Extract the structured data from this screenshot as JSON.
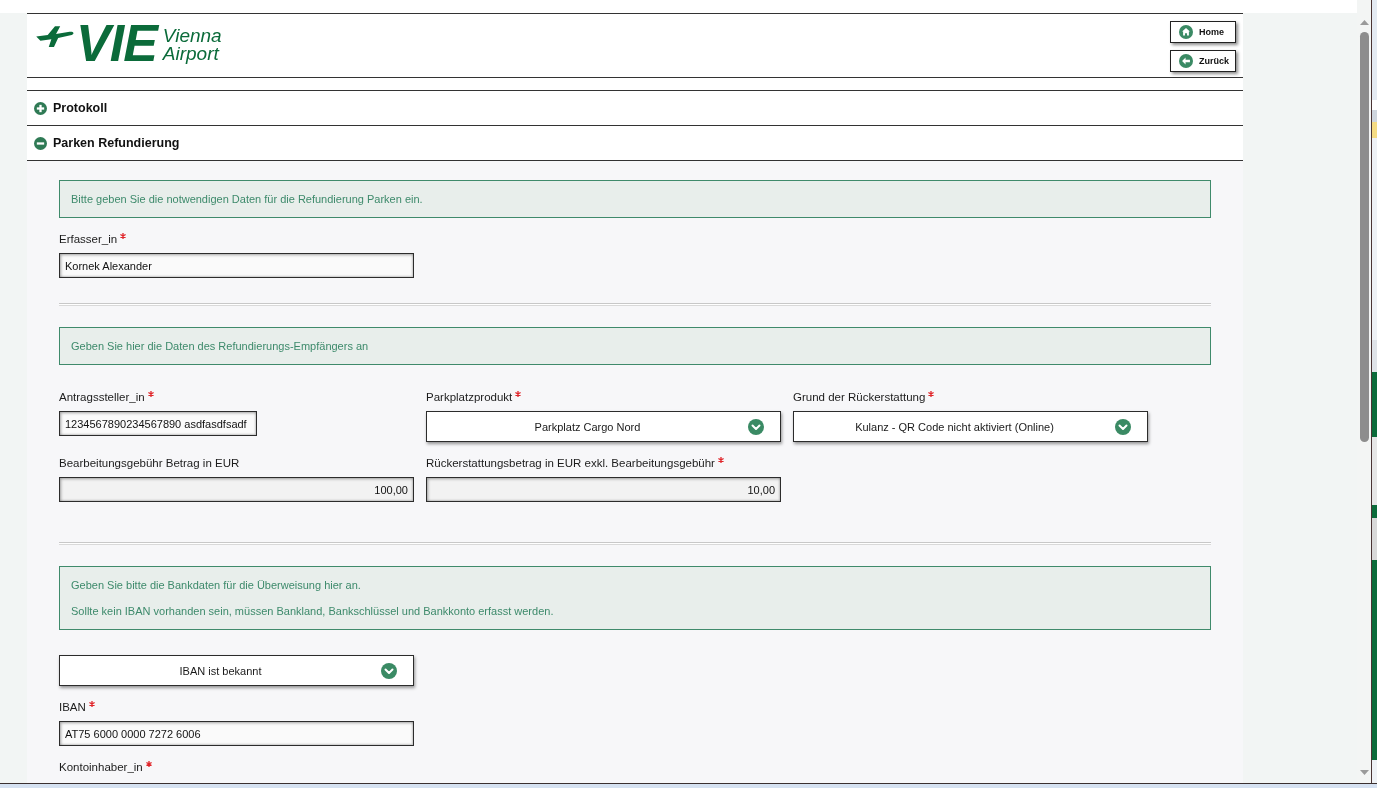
{
  "header": {
    "logo": {
      "mark": "VIE",
      "lines": [
        "Vienna",
        "Airport"
      ]
    },
    "buttons": [
      {
        "kind": "home",
        "label": "Home"
      },
      {
        "kind": "back",
        "label": "Zurück"
      }
    ]
  },
  "accordion": [
    {
      "label": "Protokoll",
      "expanded": false
    },
    {
      "label": "Parken Refundierung",
      "expanded": true,
      "sections": [
        {
          "notice": [
            "Bitte geben Sie die notwendigen Daten für die Refundierung Parken ein."
          ],
          "rows": [
            [
              {
                "kind": "text",
                "label": "Erfasser_in",
                "required": true,
                "value": "Kornek Alexander"
              }
            ]
          ]
        },
        {
          "notice": [
            "Geben Sie hier die Daten des Refundierungs-Empfängers an"
          ],
          "rows": [
            [
              {
                "kind": "text",
                "label": "Antragssteller_in",
                "required": true,
                "value": "1234567890234567890 asdfasdfsadf"
              },
              {
                "kind": "select",
                "label": "Parkplatzprodukt",
                "required": true,
                "value": "Parkplatz Cargo Nord"
              },
              {
                "kind": "select",
                "label": "Grund der Rückerstattung",
                "required": true,
                "value": "Kulanz - QR Code nicht aktiviert (Online)"
              }
            ],
            [
              {
                "kind": "amount",
                "label": "Bearbeitungsgebühr Betrag in EUR",
                "value": "100,00"
              },
              {
                "kind": "amount",
                "label": "Rückerstattungsbetrag in EUR exkl. Bearbeitungsgebühr",
                "required": true,
                "value": "10,00"
              }
            ]
          ]
        },
        {
          "notice": [
            "Geben Sie bitte die Bankdaten für die Überweisung hier an.",
            "Sollte kein IBAN vorhanden sein, müssen Bankland, Bankschlüssel und Bankkonto erfasst werden."
          ],
          "rows": [
            [
              {
                "kind": "select",
                "value": "IBAN ist bekannt"
              }
            ],
            [
              {
                "kind": "text",
                "label": "IBAN",
                "required": true,
                "value": "AT75 6000 0000 7272 6006"
              }
            ],
            [
              {
                "kind": "label",
                "label": "Kontoinhaber_in",
                "required": true
              }
            ]
          ]
        }
      ]
    }
  ]
}
